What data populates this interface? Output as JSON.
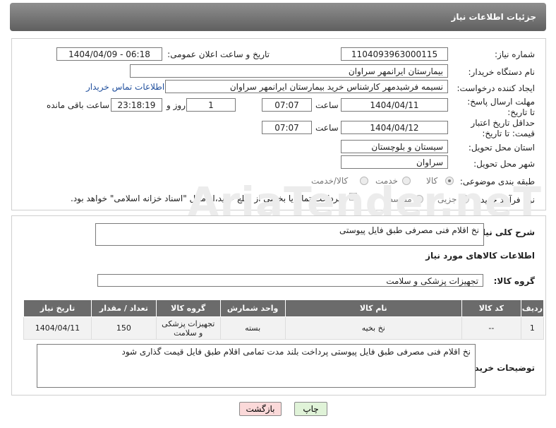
{
  "header": {
    "title": "جزئیات اطلاعات نیاز"
  },
  "form": {
    "need_number_label": "شماره نیاز:",
    "need_number": "1104093963000115",
    "announce_label": "تاریخ و ساعت اعلان عمومی:",
    "announce_value": "1404/04/09 - 06:18",
    "buyer_org_label": "نام دستگاه خریدار:",
    "buyer_org": "بیمارستان ایرانمهر سراوان",
    "creator_label": "ایجاد کننده درخواست:",
    "creator": "نسیمه فرشیدمهر کارشناس خرید بیمارستان ایرانمهر سراوان",
    "contact_link": "اطلاعات تماس خریدار",
    "reply_deadline_label": "مهلت ارسال پاسخ: تا تاریخ:",
    "reply_date": "1404/04/11",
    "hour_label": "ساعت",
    "reply_time": "07:07",
    "reply_days": "1",
    "days_label": "روز و",
    "remaining_time": "23:18:19",
    "remaining_label": "ساعت باقی مانده",
    "price_validity_label": "حداقل تاریخ اعتبار قیمت: تا تاریخ:",
    "price_date": "1404/04/12",
    "price_hour_label": "ساعت",
    "price_time": "07:07",
    "province_label": "استان محل تحویل:",
    "province": "سیستان و بلوچستان",
    "city_label": "شهر محل تحویل:",
    "city": "سراوان",
    "category_label": "طبقه بندی موضوعی:",
    "category_options": [
      "کالا",
      "خدمت",
      "کالا/خدمت"
    ],
    "process_label": "نوع فرآیند خرید :",
    "process_options": [
      "جزیی",
      "متوسط"
    ],
    "payment_note": "پرداخت تمام یا بخشی از مبلغ خرید،از محل \"اسناد خزانه اسلامی\" خواهد بود."
  },
  "description": {
    "label": "شرح کلی نیاز:",
    "value": "نخ اقلام فنی مصرفی طبق فایل پیوستی"
  },
  "goods_info": {
    "title": "اطلاعات کالاهای مورد نیاز",
    "group_label": "گروه کالا:",
    "group_value": "تجهیزات پزشکی و سلامت"
  },
  "table": {
    "headers": [
      "ردیف",
      "کد کالا",
      "نام کالا",
      "واحد شمارش",
      "گروه کالا",
      "تعداد / مقدار",
      "تاریخ نیاز"
    ],
    "rows": [
      [
        "1",
        "--",
        "نخ بخیه",
        "بسته",
        "تجهیزات پزشکی و سلامت",
        "150",
        "1404/04/11"
      ]
    ]
  },
  "buyer_notes": {
    "label": "توضیحات خریدار:",
    "value": "نخ اقلام فنی مصرفی طبق فایل پیوستی پرداخت بلند مدت تمامی اقلام طبق فایل قیمت گذاری شود"
  },
  "buttons": {
    "print": "چاپ",
    "back": "بازگشت"
  },
  "colors": {
    "header_bg": "#6b6b6b",
    "link": "#1f4e9c",
    "back_button_bg": "#fbd9d9",
    "print_button_bg": "#e0f3d8"
  }
}
